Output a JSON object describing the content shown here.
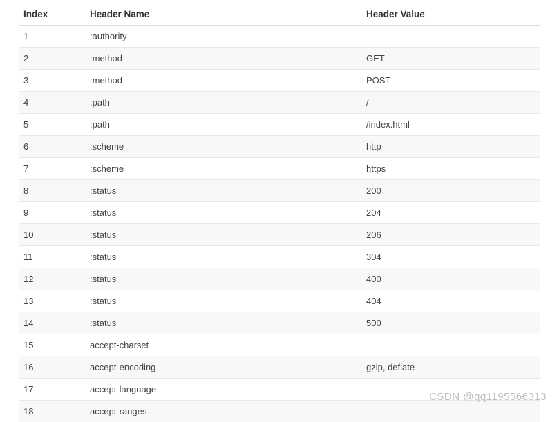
{
  "table": {
    "columns": [
      "Index",
      "Header Name",
      "Header Value"
    ],
    "rows": [
      {
        "index": "1",
        "name": ":authority",
        "value": ""
      },
      {
        "index": "2",
        "name": ":method",
        "value": "GET"
      },
      {
        "index": "3",
        "name": ":method",
        "value": "POST"
      },
      {
        "index": "4",
        "name": ":path",
        "value": "/"
      },
      {
        "index": "5",
        "name": ":path",
        "value": "/index.html"
      },
      {
        "index": "6",
        "name": ":scheme",
        "value": "http"
      },
      {
        "index": "7",
        "name": ":scheme",
        "value": "https"
      },
      {
        "index": "8",
        "name": ":status",
        "value": "200"
      },
      {
        "index": "9",
        "name": ":status",
        "value": "204"
      },
      {
        "index": "10",
        "name": ":status",
        "value": "206"
      },
      {
        "index": "11",
        "name": ":status",
        "value": "304"
      },
      {
        "index": "12",
        "name": ":status",
        "value": "400"
      },
      {
        "index": "13",
        "name": ":status",
        "value": "404"
      },
      {
        "index": "14",
        "name": ":status",
        "value": "500"
      },
      {
        "index": "15",
        "name": "accept-charset",
        "value": ""
      },
      {
        "index": "16",
        "name": "accept-encoding",
        "value": "gzip, deflate"
      },
      {
        "index": "17",
        "name": "accept-language",
        "value": ""
      },
      {
        "index": "18",
        "name": "accept-ranges",
        "value": ""
      }
    ]
  },
  "watermark": "CSDN @qq1195566313"
}
